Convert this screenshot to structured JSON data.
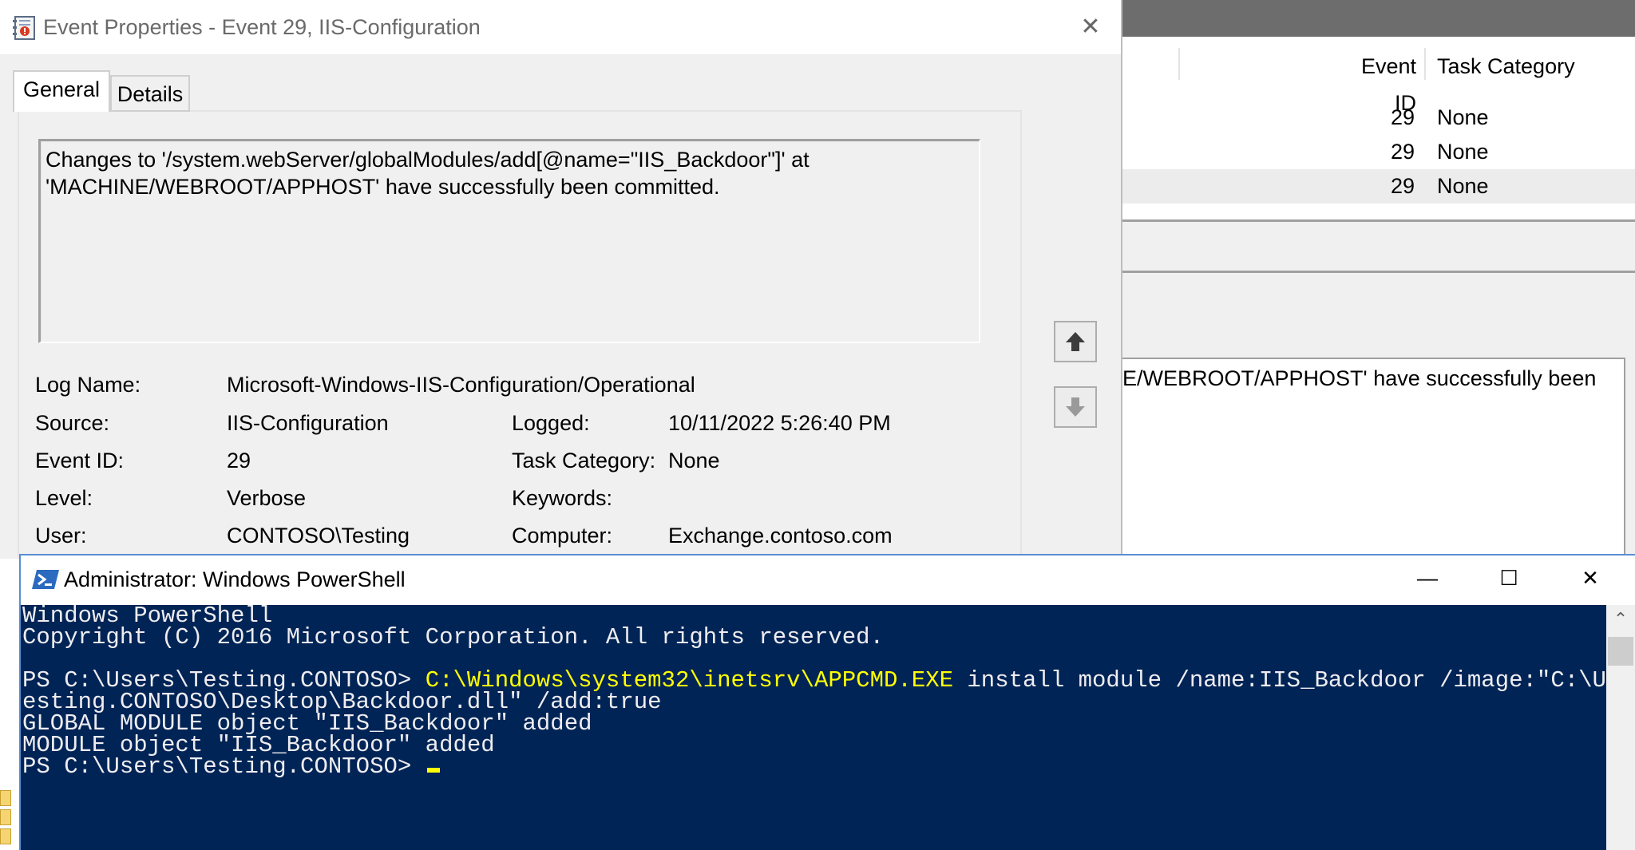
{
  "event_viewer": {
    "columns": {
      "event_id": "Event ID",
      "task_category": "Task Category"
    },
    "rows": [
      {
        "event_id": "29",
        "task_category": "None"
      },
      {
        "event_id": "29",
        "task_category": "None"
      },
      {
        "event_id": "29",
        "task_category": "None"
      }
    ],
    "description_fragment": "E/WEBROOT/APPHOST' have successfully been"
  },
  "event_properties": {
    "title": "Event Properties - Event 29, IIS-Configuration",
    "close_glyph": "✕",
    "tabs": [
      {
        "label": "General"
      },
      {
        "label": "Details"
      }
    ],
    "message": {
      "line1": "Changes to '/system.webServer/globalModules/add[@name=\"IIS_Backdoor\"]' at",
      "line2": "'MACHINE/WEBROOT/APPHOST' have successfully been committed."
    },
    "fields": {
      "log_name_label": "Log Name:",
      "log_name_value": "Microsoft-Windows-IIS-Configuration/Operational",
      "source_label": "Source:",
      "source_value": "IIS-Configuration",
      "logged_label": "Logged:",
      "logged_value": "10/11/2022 5:26:40 PM",
      "event_id_label": "Event ID:",
      "event_id_value": "29",
      "task_category_label": "Task Category:",
      "task_category_value": "None",
      "level_label": "Level:",
      "level_value": "Verbose",
      "keywords_label": "Keywords:",
      "keywords_value": "",
      "user_label": "User:",
      "user_value": "CONTOSO\\Testing",
      "computer_label": "Computer:",
      "computer_value": "Exchange.contoso.com"
    }
  },
  "powershell": {
    "title": "Administrator: Windows PowerShell",
    "controls": {
      "minimize": "—",
      "maximize": "☐",
      "close": "✕"
    },
    "console": {
      "line1": "Windows PowerShell",
      "line2": "Copyright (C) 2016 Microsoft Corporation. All rights reserved.",
      "prompt": "PS C:\\Users\\Testing.CONTOSO> ",
      "command": "C:\\Windows\\system32\\inetsrv\\APPCMD.EXE",
      "args_line1": " install module /name:IIS_Backdoor /image:\"C:\\Users\\T",
      "args_line2": "esting.CONTOSO\\Desktop\\Backdoor.dll\" /add:true",
      "output1": "GLOBAL MODULE object \"IIS_Backdoor\" added",
      "output2": "MODULE object \"IIS_Backdoor\" added",
      "prompt_final": "PS C:\\Users\\Testing.CONTOSO> "
    },
    "scroll_up_glyph": "⌃"
  },
  "colors": {
    "console_bg": "#012456",
    "console_text": "#eeedf0",
    "command_highlight": "#ffff00",
    "window_border": "#5a8ed1"
  }
}
